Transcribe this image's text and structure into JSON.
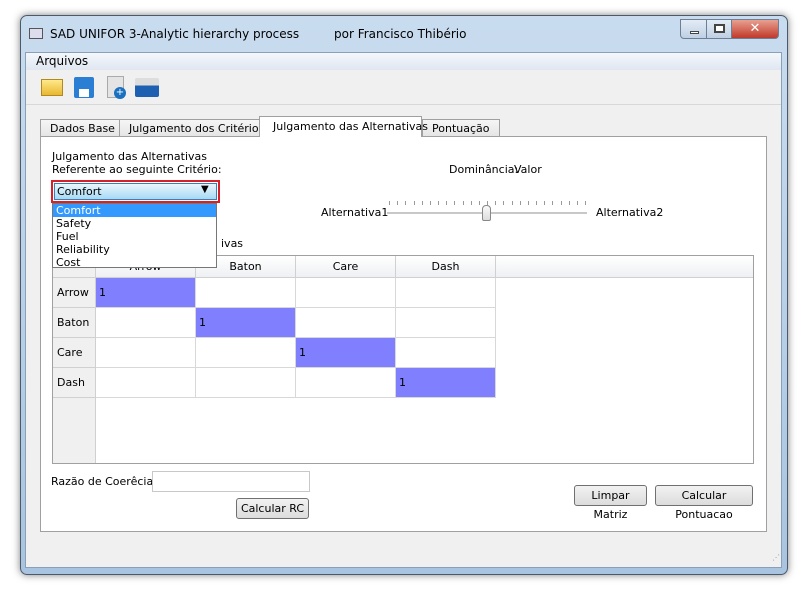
{
  "window": {
    "title": "SAD UNIFOR 3-Analytic hierarchy process",
    "author": "por Francisco Thibério"
  },
  "menu": {
    "arquivos": "Arquivos"
  },
  "toolbar": {
    "icons": [
      "open-folder-icon",
      "save-icon",
      "new-document-icon",
      "print-icon"
    ]
  },
  "tabs": [
    {
      "label": "Dados Base"
    },
    {
      "label": "Julgamento dos Critérios"
    },
    {
      "label": "Julgamento das Alternativas",
      "active": true
    },
    {
      "label": "Pontuação"
    }
  ],
  "panel": {
    "heading1": "Julgamento das Alternativas",
    "heading2": "Referente ao seguinte Critério:",
    "criterion_selected": "Comfort",
    "criterion_options": [
      "Comfort",
      "Safety",
      "Fuel",
      "Reliability",
      "Cost"
    ],
    "dominance_label": "Dominância:",
    "dominance_value": "Valor",
    "slider": {
      "left_label": "Alternativa1",
      "right_label": "Alternativa2",
      "position_fraction": 0.5
    },
    "matrix_label_fragment": "ivas",
    "matrix": {
      "columns": [
        "Arrow",
        "Baton",
        "Care",
        "Dash"
      ],
      "rows": [
        {
          "label": "Arrow",
          "cells": [
            "1",
            "",
            "",
            ""
          ]
        },
        {
          "label": "Baton",
          "cells": [
            "",
            "1",
            "",
            ""
          ]
        },
        {
          "label": "Care",
          "cells": [
            "",
            "",
            "1",
            ""
          ]
        },
        {
          "label": "Dash",
          "cells": [
            "",
            "",
            "",
            "1"
          ]
        }
      ]
    },
    "rc_label": "Razão de Coerêcia:",
    "rc_value": "",
    "calc_rc": "Calcular RC",
    "clear": "Limpar Matriz",
    "calc_score": "Calcular Pontuacao"
  },
  "colors": {
    "diagonal": "#8080ff",
    "highlight": "#d8202a",
    "selection": "#3399ff"
  }
}
